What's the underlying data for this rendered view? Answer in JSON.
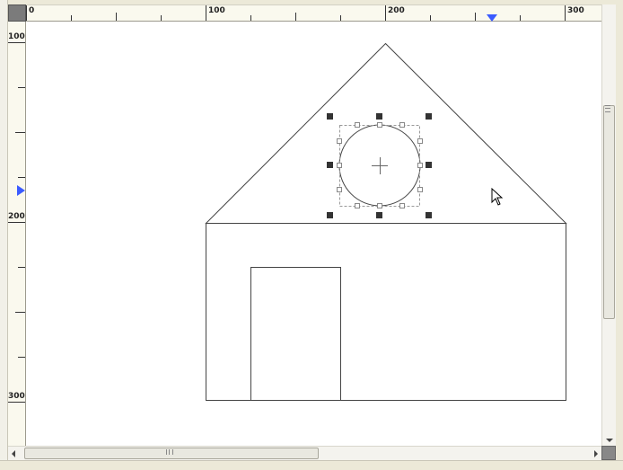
{
  "rulers": {
    "horizontal_labels": [
      "0",
      "100",
      "200",
      "300"
    ],
    "vertical_labels": [
      "100",
      "200",
      "300"
    ]
  },
  "drawing": {
    "shapes": [
      "roof-triangle",
      "house-wall-rectangle",
      "door-rectangle",
      "selected-circle-window"
    ],
    "selected_shape": "selected-circle-window"
  },
  "colors": {
    "canvas": "#ffffff",
    "ruler_bg": "#faf9ee",
    "marker": "#3b5bff",
    "chrome": "#ece9d8"
  },
  "icons": {
    "cursor": "arrow-cursor-icon",
    "h_ruler_marker": "triangle-marker-icon",
    "v_ruler_marker": "triangle-marker-icon"
  }
}
